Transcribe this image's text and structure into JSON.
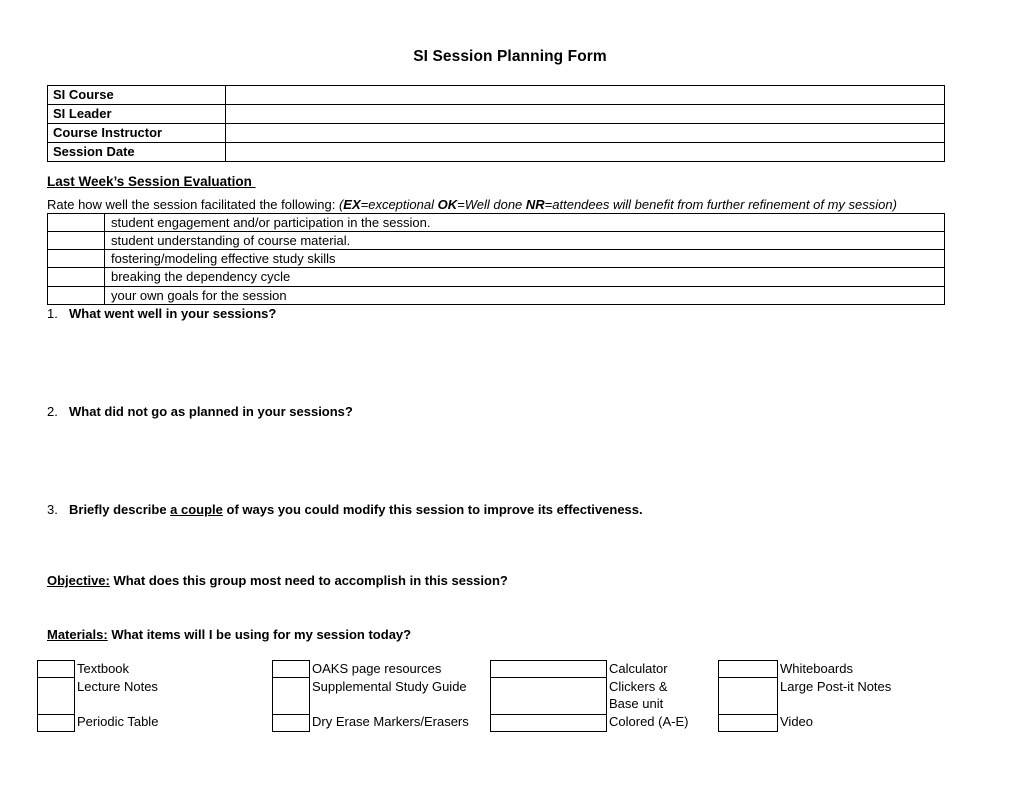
{
  "document": {
    "title": "SI Session Planning Form"
  },
  "info_table": {
    "rows": [
      {
        "label": "SI Course",
        "value": ""
      },
      {
        "label": "SI Leader",
        "value": ""
      },
      {
        "label": "Course Instructor",
        "value": ""
      },
      {
        "label": "Session Date",
        "value": ""
      }
    ]
  },
  "evaluation": {
    "heading": "Last Week’s Session Evaluation ",
    "rate_prompt": "Rate how well the session facilitated the following: ",
    "legend": {
      "open_paren": "(",
      "ex_code": "EX",
      "ex_text": "=exceptional ",
      "ok_code": "OK",
      "ok_text": "=Well done ",
      "nr_code": "NR",
      "nr_text": "=attendees will benefit from further refinement of my session)"
    },
    "criteria": [
      {
        "mark": "",
        "description": "student engagement and/or participation in the session."
      },
      {
        "mark": "",
        "description": "student understanding of course material."
      },
      {
        "mark": "",
        "description": "fostering/modeling effective study skills"
      },
      {
        "mark": "",
        "description": "breaking the dependency cycle"
      },
      {
        "mark": "",
        "description": "your own goals for the session"
      }
    ]
  },
  "questions": [
    {
      "number": "1.",
      "text": "What went well in your sessions?"
    },
    {
      "number": "2.",
      "text": "What did not go as planned in your sessions?"
    },
    {
      "number": "3.",
      "prefix": "Briefly describe ",
      "underlined": "a couple",
      "suffix": " of ways you could modify this session to improve its effectiveness."
    }
  ],
  "objective": {
    "heading": "Objective:",
    "prompt": " What does this group most need to accomplish in this session?"
  },
  "materials": {
    "heading": "Materials:",
    "prompt": " What items will I be using for my session today?",
    "columns": [
      {
        "id": "column-1",
        "items": [
          {
            "label": "Textbook",
            "checked": false,
            "size": "short"
          },
          {
            "label": "Lecture Notes",
            "checked": false,
            "size": "tall"
          },
          {
            "label": "Periodic Table",
            "checked": false,
            "size": "short"
          }
        ]
      },
      {
        "id": "column-2",
        "items": [
          {
            "label": "OAKS page resources",
            "checked": false,
            "size": "short"
          },
          {
            "label": "Supplemental Study Guide",
            "checked": false,
            "size": "tall"
          },
          {
            "label": "Dry Erase Markers/Erasers",
            "checked": false,
            "size": "short"
          }
        ]
      },
      {
        "id": "column-3",
        "items": [
          {
            "label": "Calculator",
            "checked": false,
            "size": "short"
          },
          {
            "label": "Clickers & Base unit",
            "checked": false,
            "size": "tall"
          },
          {
            "label": "Colored (A-E)",
            "checked": false,
            "size": "short"
          }
        ]
      },
      {
        "id": "column-4",
        "items": [
          {
            "label": "Whiteboards",
            "checked": false,
            "size": "short"
          },
          {
            "label": "Large Post-it Notes",
            "checked": false,
            "size": "tall"
          },
          {
            "label": "Video",
            "checked": false,
            "size": "short"
          }
        ]
      }
    ]
  }
}
